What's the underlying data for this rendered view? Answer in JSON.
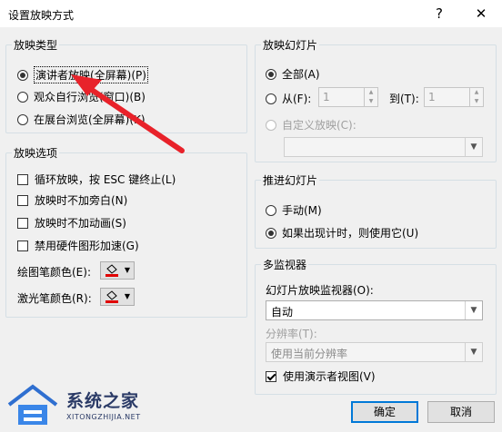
{
  "window": {
    "title": "设置放映方式",
    "help_label": "?",
    "close_label": "✕"
  },
  "show_type": {
    "title": "放映类型",
    "options": [
      "演讲者放映(全屏幕)(P)",
      "观众自行浏览(窗口)(B)",
      "在展台浏览(全屏幕)(K)"
    ],
    "selected": 0
  },
  "show_options": {
    "title": "放映选项",
    "items": [
      {
        "label": "循环放映，按 ESC 键终止(L)",
        "checked": false
      },
      {
        "label": "放映时不加旁白(N)",
        "checked": false
      },
      {
        "label": "放映时不加动画(S)",
        "checked": false
      },
      {
        "label": "禁用硬件图形加速(G)",
        "checked": false
      }
    ],
    "pen_color_label": "绘图笔颜色(E):",
    "laser_color_label": "激光笔颜色(R):",
    "pen_color": "#e00000",
    "laser_color": "#e00000"
  },
  "show_slides": {
    "title": "放映幻灯片",
    "all_label": "全部(A)",
    "from_label": "从(F):",
    "from_value": "1",
    "to_label": "到(T):",
    "to_value": "1",
    "custom_label": "自定义放映(C):",
    "custom_value": ""
  },
  "advance": {
    "title": "推进幻灯片",
    "manual_label": "手动(M)",
    "timing_label": "如果出现计时，则使用它(U)",
    "selected": 1
  },
  "monitors": {
    "title": "多监视器",
    "monitor_label": "幻灯片放映监视器(O):",
    "monitor_value": "自动",
    "resolution_label": "分辨率(T):",
    "resolution_value": "使用当前分辨率",
    "presenter_view_label": "使用演示者视图(V)",
    "presenter_view_checked": true
  },
  "buttons": {
    "ok": "确定",
    "cancel": "取消"
  },
  "watermark": {
    "name": "系统之家",
    "url": "XITONGZHIJIA.NET"
  },
  "colors": {
    "accent": "#0078d7",
    "arrow": "#e8222a",
    "group_border": "#d5dfe5"
  }
}
